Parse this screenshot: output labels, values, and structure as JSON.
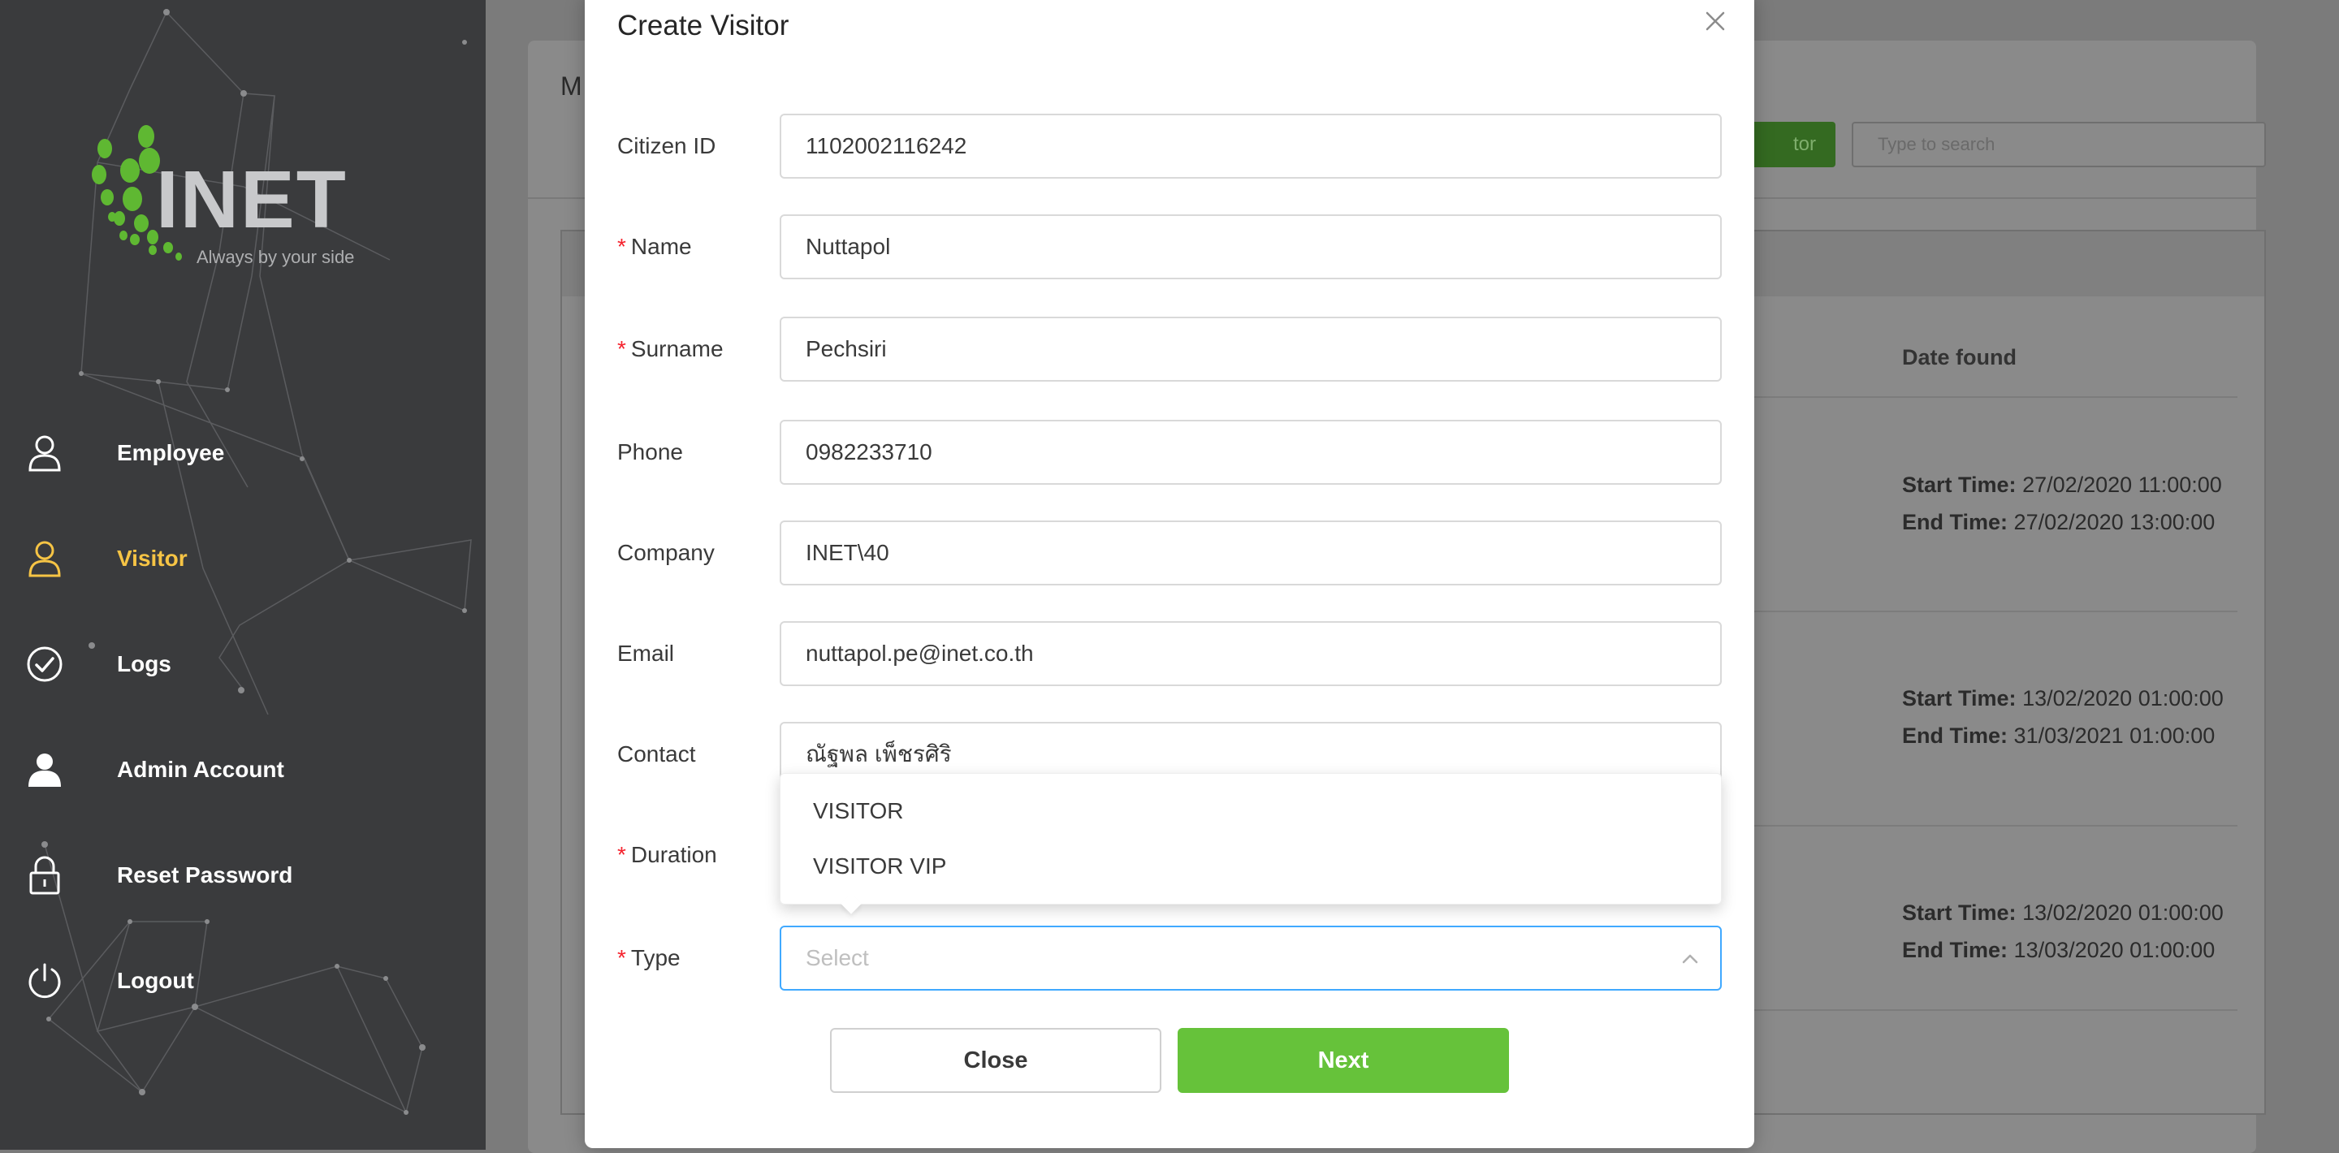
{
  "sidebar": {
    "logo_text": "INET",
    "logo_tagline": "Always by your side",
    "items": [
      {
        "label": "Employee",
        "icon": "user-outline-icon",
        "active": false
      },
      {
        "label": "Visitor",
        "icon": "user-outline-icon",
        "active": true
      },
      {
        "label": "Logs",
        "icon": "check-circle-icon",
        "active": false
      },
      {
        "label": "Admin Account",
        "icon": "user-filled-icon",
        "active": false
      },
      {
        "label": "Reset Password",
        "icon": "lock-icon",
        "active": false
      },
      {
        "label": "Logout",
        "icon": "power-icon",
        "active": false
      }
    ],
    "active_color": "#f6c445"
  },
  "background_page": {
    "title_partial": "M",
    "add_button_partial": "tor",
    "search_placeholder": "Type to search",
    "table_column": "Date found",
    "rows": [
      {
        "start_label": "Start Time:",
        "start": "27/02/2020 11:00:00",
        "end_label": "End Time:",
        "end": "27/02/2020 13:00:00"
      },
      {
        "start_label": "Start Time:",
        "start": "13/02/2020 01:00:00",
        "end_label": "End Time:",
        "end": "31/03/2021 01:00:00"
      },
      {
        "start_label": "Start Time:",
        "start": "13/02/2020 01:00:00",
        "end_label": "End Time:",
        "end": "13/03/2020 01:00:00"
      }
    ]
  },
  "modal": {
    "title": "Create Visitor",
    "fields": {
      "citizen_id": {
        "label": "Citizen ID",
        "value": "1102002116242",
        "required": false
      },
      "name": {
        "label": "Name",
        "value": "Nuttapol",
        "required": true
      },
      "surname": {
        "label": "Surname",
        "value": "Pechsiri",
        "required": true
      },
      "phone": {
        "label": "Phone",
        "value": "0982233710",
        "required": false
      },
      "company": {
        "label": "Company",
        "value": "INET\\40",
        "required": false
      },
      "email": {
        "label": "Email",
        "value": "nuttapol.pe@inet.co.th",
        "required": false
      },
      "contact": {
        "label": "Contact",
        "value": "ณัฐพล เพ็ชรศิริ",
        "required": false
      },
      "duration": {
        "label": "Duration",
        "value": "",
        "required": true
      },
      "type": {
        "label": "Type",
        "placeholder": "Select",
        "required": true
      }
    },
    "required_mark": "*",
    "type_options": [
      "VISITOR",
      "VISITOR VIP"
    ],
    "buttons": {
      "close": "Close",
      "next": "Next"
    },
    "accent_green": "#66c23a",
    "focus_blue": "#40a9ff"
  }
}
